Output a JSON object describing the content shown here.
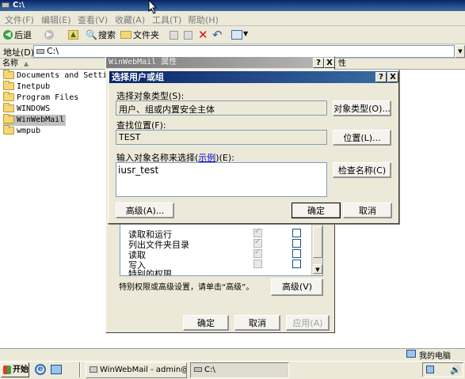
{
  "explorer": {
    "title": "C:\\",
    "menu": [
      "文件(F)",
      "编辑(E)",
      "查看(V)",
      "收藏(A)",
      "工具(T)",
      "帮助(H)"
    ],
    "toolbar": {
      "back": "后退",
      "search": "搜索",
      "folders": "文件夹"
    },
    "address_label": "地址(D)",
    "address_value": "C:\\",
    "column_name": "名称",
    "column_attr": "性",
    "tree": [
      "Documents and Settings",
      "Inetpub",
      "Program Files",
      "WINDOWS",
      "WinWebMail",
      "wmpub"
    ],
    "status_computer": "我的电脑"
  },
  "properties": {
    "title": "WinWebMail 属性",
    "help": "?",
    "close": "X",
    "permissions": [
      {
        "label": "读取和运行",
        "allow": true,
        "deny": false
      },
      {
        "label": "列出文件夹目录",
        "allow": true,
        "deny": false
      },
      {
        "label": "读取",
        "allow": true,
        "deny": false
      },
      {
        "label": "写入",
        "allow": false,
        "deny": false
      },
      {
        "label": "特别的权限",
        "allow": false,
        "deny": false
      }
    ],
    "special_note": "特别权限或高级设置，请单击“高级”。",
    "advanced": "高级(V)",
    "ok": "确定",
    "cancel": "取消",
    "apply": "应用(A)"
  },
  "select_dialog": {
    "title": "选择用户或组",
    "help": "?",
    "close": "X",
    "object_type_label": "选择对象类型(S):",
    "object_type_value": "用户、组或内置安全主体",
    "object_type_button": "对象类型(O)...",
    "location_label": "查找位置(F):",
    "location_value": "TEST",
    "location_button": "位置(L)...",
    "names_label_pre": "输入对象名称来选择(",
    "names_label_link": "示例",
    "names_label_post": ")(E):",
    "names_value": "iusr_test",
    "check_names": "检查名称(C)",
    "advanced": "高级(A)...",
    "ok": "确定",
    "cancel": "取消"
  },
  "taskbar": {
    "start": "开始",
    "tasks": [
      "WinWebMail - admin@...",
      "C:\\"
    ]
  }
}
